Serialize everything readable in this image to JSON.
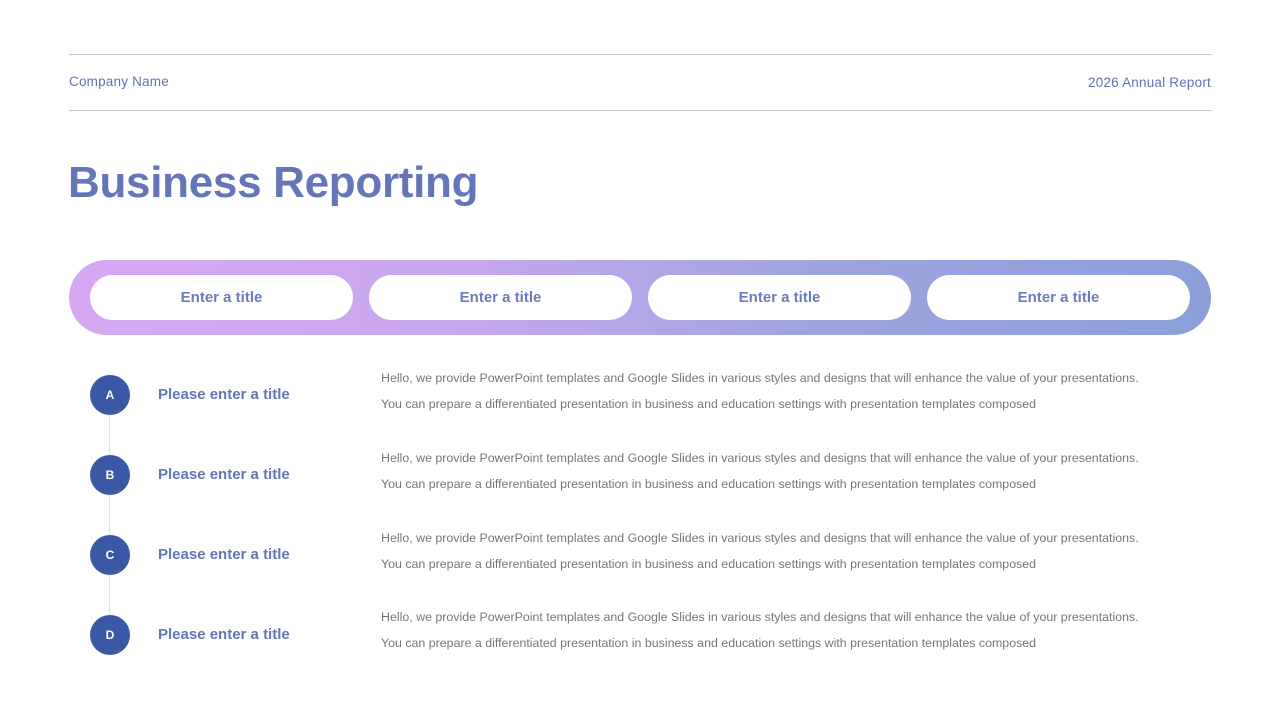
{
  "header": {
    "company": "Company Name",
    "report": "2026 Annual Report"
  },
  "title": "Business Reporting",
  "tabs": [
    {
      "label": "Enter a title"
    },
    {
      "label": "Enter a title"
    },
    {
      "label": "Enter a title"
    },
    {
      "label": "Enter a title"
    }
  ],
  "items": [
    {
      "letter": "A",
      "title": "Please enter a title",
      "line1": "Hello, we provide PowerPoint templates and Google Slides in various styles and designs that will enhance the value of your presentations.",
      "line2": "You can prepare a differentiated presentation in business and education settings with presentation templates composed"
    },
    {
      "letter": "B",
      "title": "Please enter a title",
      "line1": "Hello, we provide PowerPoint templates and Google Slides in various styles and designs that will enhance the value of your presentations.",
      "line2": "You can prepare a differentiated presentation in business and education settings with presentation templates composed"
    },
    {
      "letter": "C",
      "title": "Please enter a title",
      "line1": "Hello, we provide PowerPoint templates and Google Slides in various styles and designs that will enhance the value of your presentations.",
      "line2": "You can prepare a differentiated presentation in business and education settings with presentation templates composed"
    },
    {
      "letter": "D",
      "title": "Please enter a title",
      "line1": "Hello, we provide PowerPoint templates and Google Slides in various styles and designs that will enhance the value of your presentations.",
      "line2": "You can prepare a differentiated presentation in business and education settings with presentation templates composed"
    }
  ],
  "colors": {
    "accent": "#6476b8",
    "badge": "#3a58a6",
    "gradient_start": "#d7a8f4",
    "gradient_end": "#8a9fd9",
    "body_text": "#76767a"
  }
}
